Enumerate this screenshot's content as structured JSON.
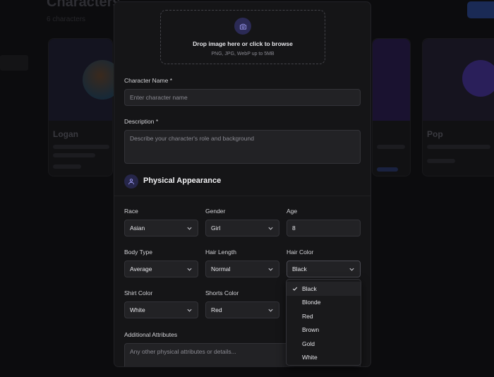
{
  "background": {
    "title": "Characters",
    "subtitle": "6 characters",
    "card_left_name": "Logan",
    "card_right_name": "Pop"
  },
  "upload": {
    "title": "Drop image here or click to browse",
    "hint": "PNG, JPG, WebP up to 5MB"
  },
  "name": {
    "label": "Character Name *",
    "placeholder": "Enter character name"
  },
  "description": {
    "label": "Description *",
    "placeholder": "Describe your character's role and background"
  },
  "appearance": {
    "title": "Physical Appearance",
    "race": {
      "label": "Race",
      "value": "Asian"
    },
    "gender": {
      "label": "Gender",
      "value": "Girl"
    },
    "age": {
      "label": "Age",
      "value": "8"
    },
    "body_type": {
      "label": "Body Type",
      "value": "Average"
    },
    "hair_length": {
      "label": "Hair Length",
      "value": "Normal"
    },
    "hair_color": {
      "label": "Hair Color",
      "value": "Black"
    },
    "shirt_color": {
      "label": "Shirt Color",
      "value": "White"
    },
    "shorts_color": {
      "label": "Shorts Color",
      "value": "Red"
    }
  },
  "additional": {
    "label": "Additional Attributes",
    "placeholder": "Any other physical attributes or details..."
  },
  "hair_color_options": [
    "Black",
    "Blonde",
    "Red",
    "Brown",
    "Gold",
    "White"
  ],
  "hair_color_selected": "Black",
  "colors": {
    "accent": "#6d6af0",
    "modal_bg": "#151517",
    "field_bg": "#222225"
  }
}
